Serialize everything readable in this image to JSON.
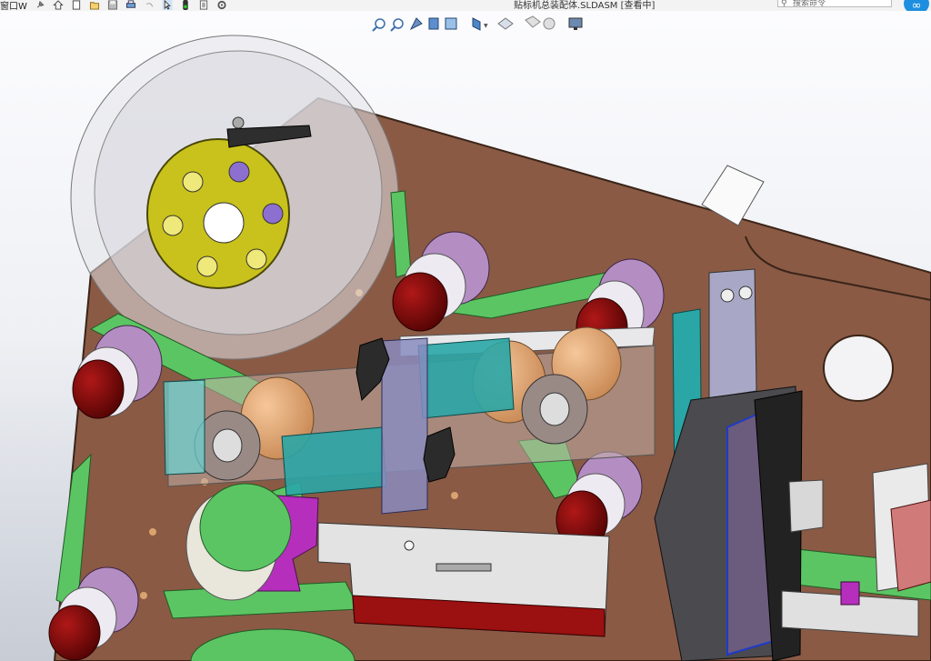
{
  "window": {
    "document_title": "贴标机总装配体.SLDASM [查看中]",
    "search_placeholder": "搜索命令",
    "left_tag": "窗口W"
  },
  "headsup_toolbar": {
    "tools": [
      "zoom-to-fit-icon",
      "zoom-area-icon",
      "previous-view-icon",
      "section-view-icon",
      "dynamic-annotation-icon",
      "view-orientation-icon",
      "display-style-icon",
      "hide-show-icon",
      "edit-appearance-icon",
      "apply-scene-icon",
      "view-settings-icon"
    ]
  },
  "colors": {
    "background_top": "#fbfbfd",
    "background_bottom": "#c9ced6",
    "plate": "#8a5a45",
    "belt_green": "#5cc563",
    "roller_red": "#7a0a0a",
    "roller_purple": "#b48ec2",
    "magenta_bracket": "#b52fbc",
    "teal_bracket": "#2aa6a6",
    "spool_yellow": "#c9c21c"
  }
}
